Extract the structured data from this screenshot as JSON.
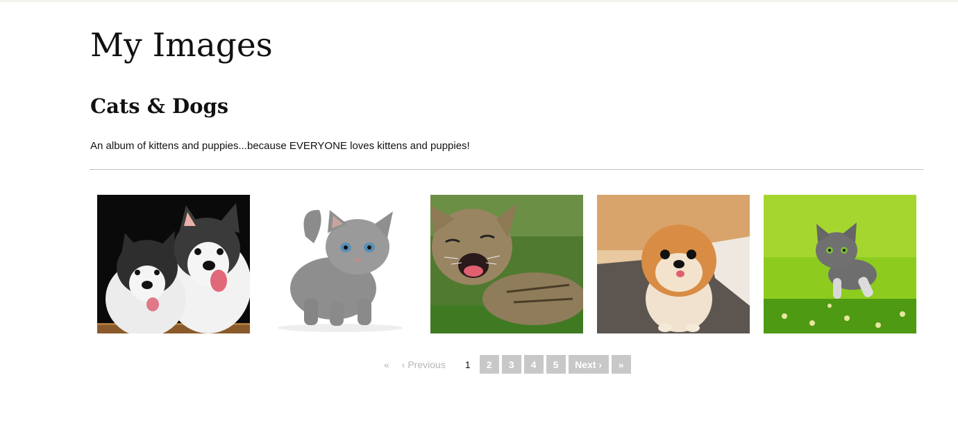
{
  "page": {
    "title": "My Images"
  },
  "album": {
    "title": "Cats & Dogs",
    "description": "An album of kittens and puppies...because EVERYONE loves kittens and puppies!"
  },
  "gallery": {
    "images": [
      {
        "subject": "two husky puppies"
      },
      {
        "subject": "grey kitten standing"
      },
      {
        "subject": "tabby kitten laughing on grass"
      },
      {
        "subject": "pomeranian puppy"
      },
      {
        "subject": "grey kitten leaping on grass"
      }
    ]
  },
  "pagination": {
    "first": "«",
    "previous": "‹ Previous",
    "current": "1",
    "pages": [
      "2",
      "3",
      "4",
      "5"
    ],
    "next": "Next ›",
    "last": "»"
  },
  "colors": {
    "text": "#111111",
    "pager_button": "#c8c8c8",
    "pager_disabled": "#b6b6b6"
  }
}
